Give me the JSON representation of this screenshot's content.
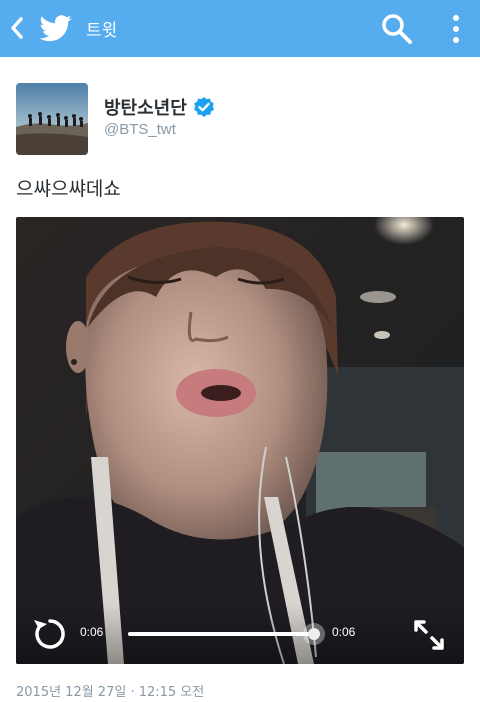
{
  "appbar": {
    "title": "트윗",
    "bg_color": "#55acee",
    "icons": [
      "chevron-left-icon",
      "twitter-bird-icon",
      "search-icon",
      "more-vertical-icon"
    ]
  },
  "tweet": {
    "author_name": "방탄소년단",
    "author_handle": "@BTS_twt",
    "verified": true,
    "text": "으쌰으쌰데쇼",
    "timestamp": "2015년 12월 27일 · 12:15 오전"
  },
  "video": {
    "elapsed": "0:06",
    "duration": "0:06",
    "progress": 1.0,
    "icons": [
      "replay-icon",
      "fullscreen-icon"
    ]
  }
}
